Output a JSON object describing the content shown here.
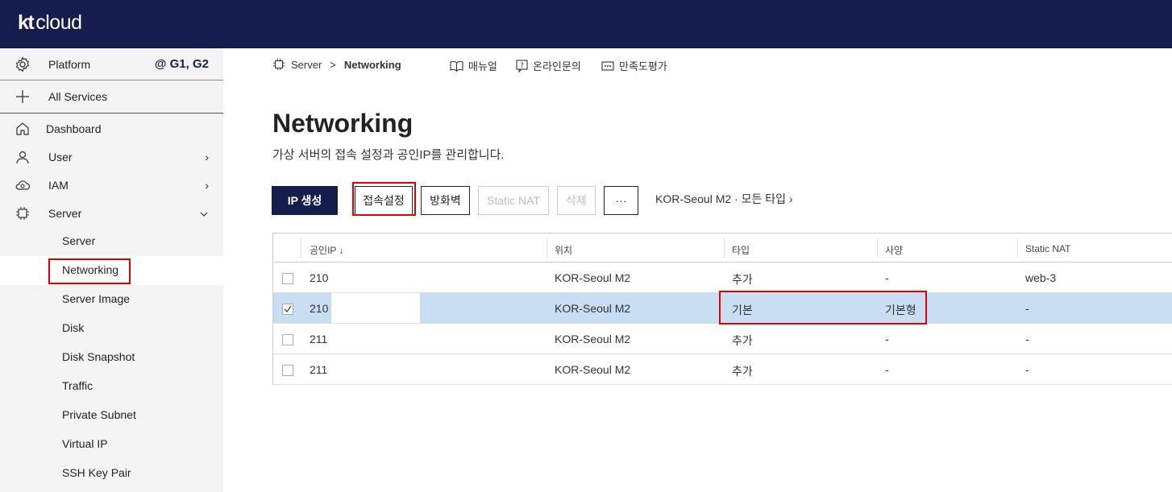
{
  "app": {
    "logo_kt": "kt",
    "logo_cloud": "cloud"
  },
  "sidebar": {
    "platform_label": "Platform",
    "platform_badge": "@ G1, G2",
    "all_services": "All Services",
    "items": [
      {
        "label": "Dashboard",
        "icon": "home-icon"
      },
      {
        "label": "User",
        "icon": "user-icon",
        "chevron": "›"
      },
      {
        "label": "IAM",
        "icon": "cloud-icon",
        "chevron": "›"
      },
      {
        "label": "Server",
        "icon": "chip-icon",
        "chevron": "⌄"
      }
    ],
    "sub_items": [
      "Server",
      "Networking",
      "Server Image",
      "Disk",
      "Disk Snapshot",
      "Traffic",
      "Private Subnet",
      "Virtual IP",
      "SSH Key Pair"
    ],
    "active_sub": "Networking"
  },
  "breadcrumb": {
    "parent": "Server",
    "separator": ">",
    "current": "Networking"
  },
  "toolbar": {
    "manual": "매뉴얼",
    "inquiry": "온라인문의",
    "survey": "만족도평가"
  },
  "page": {
    "title": "Networking",
    "description": "가상 서버의 접속 설정과 공인IP를 관리합니다."
  },
  "actions": {
    "create_ip": "IP 생성",
    "access_settings": "접속설정",
    "firewall": "방화벽",
    "static_nat": "Static NAT",
    "delete": "삭제",
    "more": "···",
    "filter": "KOR-Seoul M2 · 모든 타입 ›"
  },
  "table": {
    "columns": [
      "공인IP ↓",
      "위치",
      "타입",
      "사양",
      "Static NAT"
    ],
    "rows": [
      {
        "ip": "210",
        "location": "KOR-Seoul M2",
        "type": "추가",
        "spec": "-",
        "static_nat": "web-3",
        "checked": false
      },
      {
        "ip": "210",
        "location": "KOR-Seoul M2",
        "type": "기본",
        "spec": "기본형",
        "static_nat": "-",
        "checked": true
      },
      {
        "ip": "211",
        "location": "KOR-Seoul M2",
        "type": "추가",
        "spec": "-",
        "static_nat": "-",
        "checked": false
      },
      {
        "ip": "211",
        "location": "KOR-Seoul M2",
        "type": "추가",
        "spec": "-",
        "static_nat": "-",
        "checked": false
      }
    ]
  },
  "colors": {
    "brand_navy": "#141d4b",
    "selected_row": "#c9def3",
    "highlight": "#e00000"
  }
}
